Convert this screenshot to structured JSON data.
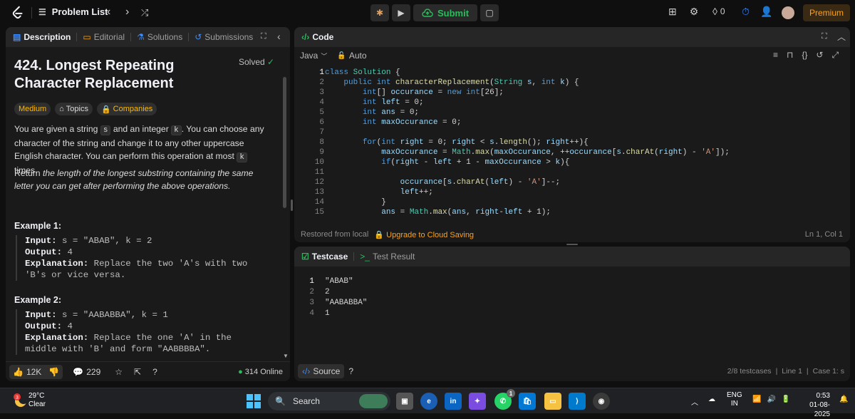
{
  "topbar": {
    "title": "Problem List",
    "submit_label": "Submit",
    "streak_count": "0",
    "premium_label": "Premium"
  },
  "left_panel": {
    "tabs": [
      {
        "label": "Description",
        "icon": "doc-icon"
      },
      {
        "label": "Editorial",
        "icon": "book-icon"
      },
      {
        "label": "Solutions",
        "icon": "flask-icon"
      },
      {
        "label": "Submissions",
        "icon": "history-icon"
      }
    ],
    "problem_title": "424. Longest Repeating Character Replacement",
    "solved_label": "Solved",
    "difficulty": "Medium",
    "topics_label": "Topics",
    "companies_label": "Companies",
    "para1_a": "You are given a string ",
    "para1_code1": "s",
    "para1_b": " and an integer ",
    "para1_code2": "k",
    "para1_c": ". You can choose any character of the string and change it to any other uppercase English character. You can perform this operation at most ",
    "para1_code3": "k",
    "para1_d": " times.",
    "para2_a": "Return ",
    "para2_b": "the length of the longest substring containing the same letter you can get after performing the above operations.",
    "example1_title": "Example 1:",
    "example1_input_label": "Input:",
    "example1_input": " s = \"ABAB\", k = 2",
    "example1_output_label": "Output:",
    "example1_output": " 4",
    "example1_expl_label": "Explanation:",
    "example1_expl": " Replace the two 'A's with two 'B's or vice versa.",
    "example2_title": "Example 2:",
    "example2_input_label": "Input:",
    "example2_input": " s = \"AABABBA\", k = 1",
    "example2_output_label": "Output:",
    "example2_output": " 4",
    "example2_expl_label": "Explanation:",
    "example2_expl": " Replace the one 'A' in the middle with 'B' and form \"AABBBBA\".",
    "likes": "12K",
    "comments": "229",
    "online": "314 Online"
  },
  "code_panel": {
    "title": "Code",
    "language": "Java",
    "mode": "Auto",
    "lines": [
      {
        "n": "1",
        "html": [
          [
            "kw",
            "class "
          ],
          [
            "ty",
            "Solution "
          ],
          [
            "pl2",
            "{"
          ]
        ]
      },
      {
        "n": "2",
        "html": [
          [
            "pl2",
            "    "
          ],
          [
            "kw",
            "public int "
          ],
          [
            "fn",
            "characterReplacement"
          ],
          [
            "pl2",
            "("
          ],
          [
            "ty",
            "String "
          ],
          [
            "id",
            "s"
          ],
          [
            "pl2",
            ", "
          ],
          [
            "kw",
            "int "
          ],
          [
            "id",
            "k"
          ],
          [
            "pl2",
            ") {"
          ]
        ]
      },
      {
        "n": "3",
        "html": [
          [
            "pl2",
            "        "
          ],
          [
            "kw",
            "int"
          ],
          [
            "pl2",
            "[] "
          ],
          [
            "id",
            "occurance"
          ],
          [
            "pl2",
            " = "
          ],
          [
            "kw",
            "new int"
          ],
          [
            "pl2",
            "[26];"
          ]
        ]
      },
      {
        "n": "4",
        "html": [
          [
            "pl2",
            "        "
          ],
          [
            "kw",
            "int "
          ],
          [
            "id",
            "left"
          ],
          [
            "pl2",
            " = 0;"
          ]
        ]
      },
      {
        "n": "5",
        "html": [
          [
            "pl2",
            "        "
          ],
          [
            "kw",
            "int "
          ],
          [
            "id",
            "ans"
          ],
          [
            "pl2",
            " = 0;"
          ]
        ]
      },
      {
        "n": "6",
        "html": [
          [
            "pl2",
            "        "
          ],
          [
            "kw",
            "int "
          ],
          [
            "id",
            "maxOccurance"
          ],
          [
            "pl2",
            " = 0;"
          ]
        ]
      },
      {
        "n": "7",
        "html": [
          [
            "pl2",
            ""
          ]
        ]
      },
      {
        "n": "8",
        "html": [
          [
            "pl2",
            "        "
          ],
          [
            "kw",
            "for"
          ],
          [
            "pl2",
            "("
          ],
          [
            "kw",
            "int "
          ],
          [
            "id",
            "right"
          ],
          [
            "pl2",
            " = 0; "
          ],
          [
            "id",
            "right"
          ],
          [
            "pl2",
            " < "
          ],
          [
            "id",
            "s"
          ],
          [
            "pl2",
            "."
          ],
          [
            "fn",
            "length"
          ],
          [
            "pl2",
            "(); "
          ],
          [
            "id",
            "right"
          ],
          [
            "pl2",
            "++){"
          ]
        ]
      },
      {
        "n": "9",
        "html": [
          [
            "pl2",
            "            "
          ],
          [
            "id",
            "maxOccurance"
          ],
          [
            "pl2",
            " = "
          ],
          [
            "ty",
            "Math"
          ],
          [
            "pl2",
            "."
          ],
          [
            "fn",
            "max"
          ],
          [
            "pl2",
            "("
          ],
          [
            "id",
            "maxOccurance"
          ],
          [
            "pl2",
            ", ++"
          ],
          [
            "id",
            "occurance"
          ],
          [
            "pl2",
            "["
          ],
          [
            "id",
            "s"
          ],
          [
            "pl2",
            "."
          ],
          [
            "fn",
            "charAt"
          ],
          [
            "pl2",
            "("
          ],
          [
            "id",
            "right"
          ],
          [
            "pl2",
            ") - "
          ],
          [
            "str",
            "'A'"
          ],
          [
            "pl2",
            "]);"
          ]
        ]
      },
      {
        "n": "10",
        "html": [
          [
            "pl2",
            "            "
          ],
          [
            "kw",
            "if"
          ],
          [
            "pl2",
            "("
          ],
          [
            "id",
            "right"
          ],
          [
            "pl2",
            " - "
          ],
          [
            "id",
            "left"
          ],
          [
            "pl2",
            " + 1 - "
          ],
          [
            "id",
            "maxOccurance"
          ],
          [
            "pl2",
            " > "
          ],
          [
            "id",
            "k"
          ],
          [
            "pl2",
            "){"
          ]
        ]
      },
      {
        "n": "11",
        "html": [
          [
            "pl2",
            ""
          ]
        ]
      },
      {
        "n": "12",
        "html": [
          [
            "pl2",
            "                "
          ],
          [
            "id",
            "occurance"
          ],
          [
            "pl2",
            "["
          ],
          [
            "id",
            "s"
          ],
          [
            "pl2",
            "."
          ],
          [
            "fn",
            "charAt"
          ],
          [
            "pl2",
            "("
          ],
          [
            "id",
            "left"
          ],
          [
            "pl2",
            ") - "
          ],
          [
            "str",
            "'A'"
          ],
          [
            "pl2",
            "]--;"
          ]
        ]
      },
      {
        "n": "13",
        "html": [
          [
            "pl2",
            "                "
          ],
          [
            "id",
            "left"
          ],
          [
            "pl2",
            "++;"
          ]
        ]
      },
      {
        "n": "14",
        "html": [
          [
            "pl2",
            "            }"
          ]
        ]
      },
      {
        "n": "15",
        "html": [
          [
            "pl2",
            "            "
          ],
          [
            "id",
            "ans"
          ],
          [
            "pl2",
            " = "
          ],
          [
            "ty",
            "Math"
          ],
          [
            "pl2",
            "."
          ],
          [
            "fn",
            "max"
          ],
          [
            "pl2",
            "("
          ],
          [
            "id",
            "ans"
          ],
          [
            "pl2",
            ", "
          ],
          [
            "id",
            "right"
          ],
          [
            "pl2",
            "-"
          ],
          [
            "id",
            "left"
          ],
          [
            "pl2",
            " + 1);"
          ]
        ]
      }
    ],
    "restored": "Restored from local",
    "upgrade": "Upgrade to Cloud Saving",
    "position": "Ln 1, Col 1"
  },
  "test_panel": {
    "tab_testcase": "Testcase",
    "tab_result": "Test Result",
    "lines": [
      {
        "n": "1",
        "text": "\"ABAB\""
      },
      {
        "n": "2",
        "text": "2"
      },
      {
        "n": "3",
        "text": "\"AABABBA\""
      },
      {
        "n": "4",
        "text": "1"
      }
    ],
    "source_label": "Source",
    "testcases": "2/8 testcases",
    "line": "Line 1",
    "case": "Case 1: s"
  },
  "taskbar": {
    "weather_badge": "3",
    "temp": "29°C",
    "condition": "Clear",
    "search_label": "Search",
    "whatsapp_badge": "1",
    "lang1": "ENG",
    "lang2": "IN",
    "time": "0:53",
    "date": "01-08-2025"
  },
  "colors": {
    "accent_green": "#2cbb5d",
    "accent_orange": "#ffa116",
    "medium": "#ffb800"
  }
}
